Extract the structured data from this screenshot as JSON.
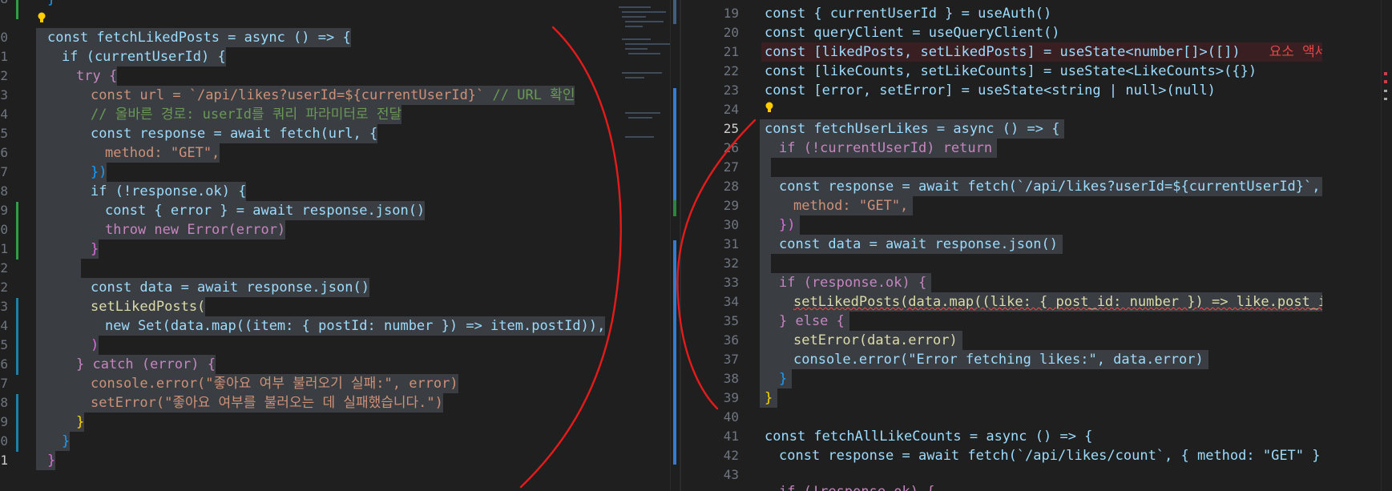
{
  "left_editor": {
    "line_numbers": [
      "8",
      "0",
      "1",
      "2",
      "3",
      "4",
      "5",
      "6",
      "7",
      "8",
      "9",
      "0",
      "1",
      "2",
      "2",
      "3",
      "4",
      "5",
      "6",
      "7",
      "8",
      "9",
      "0",
      "1",
      "2"
    ],
    "code": {
      "l0": "}",
      "l1": "const fetchLikedPosts = async () => {",
      "l2": "if (currentUserId) {",
      "l3": "try {",
      "l4_code": "const url = `/api/likes?userId=${currentUserId}`",
      "l4_comment": "// URL 확인",
      "l5": "// 올바른 경로: userId를 쿼리 파라미터로 전달",
      "l6": "const response = await fetch(url, {",
      "l7": "method: \"GET\",",
      "l8": "})",
      "l9": "if (!response.ok) {",
      "l10": "const { error } = await response.json()",
      "l11": "throw new Error(error)",
      "l12": "}",
      "l14": "const data = await response.json()",
      "l15": "setLikedPosts(",
      "l16": "new Set(data.map((item: { postId: number }) => item.postId)),",
      "l17": ")",
      "l18": "} catch (error) {",
      "l19": "console.error(\"좋아요 여부 불러오기 실패:\", error)",
      "l20": "setError(\"좋아요 여부를 불러오는 데 실패했습니다.\")",
      "l21": "}",
      "l22": "}",
      "l23": "}"
    }
  },
  "right_editor": {
    "line_numbers": [
      "19",
      "20",
      "21",
      "22",
      "23",
      "24",
      "25",
      "26",
      "27",
      "28",
      "29",
      "30",
      "31",
      "32",
      "33",
      "34",
      "35",
      "36",
      "37",
      "38",
      "39",
      "40",
      "41",
      "42",
      "43"
    ],
    "active_line": "25",
    "code": {
      "l19": "const { currentUserId } = useAuth()",
      "l20": "const queryClient = useQueryClient()",
      "l21": "const [likedPosts, setLikedPosts] = useState<number[]>([])",
      "l21_inlay": "요소 액세스 식은",
      "l22": "const [likeCounts, setLikeCounts] = useState<LikeCounts>({})",
      "l23": "const [error, setError] = useState<string | null>(null)",
      "l25": "const fetchUserLikes = async () => {",
      "l26": "if (!currentUserId) return",
      "l28": "const response = await fetch(`/api/likes?userId=${currentUserId}`, {",
      "l29": "method: \"GET\",",
      "l30": "})",
      "l31": "const data = await response.json()",
      "l33": "if (response.ok) {",
      "l34": "setLikedPosts(data.map((like: { post_id: number }) => like.post_id))",
      "l35": "} else {",
      "l36": "setError(data.error)",
      "l37": "console.error(\"Error fetching likes:\", data.error)",
      "l38": "}",
      "l39": "}",
      "l41": "const fetchAllLikeCounts = async () => {",
      "l42": "const response = await fetch(`/api/likes/count`, { method: \"GET\" })",
      "l43": "if (!response.ok) {"
    }
  },
  "colors": {
    "background": "#1f1f1f",
    "selection": "#3a3d41",
    "annotation_ink": "#e51b1b",
    "git_added": "#2ea043",
    "git_modified": "#1b81a8"
  },
  "icons": [
    "lightbulb-icon"
  ]
}
